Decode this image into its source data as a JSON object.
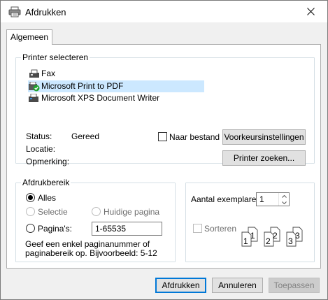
{
  "window": {
    "title": "Afdrukken"
  },
  "tabs": [
    {
      "label": "Algemeen"
    }
  ],
  "printer_group": {
    "title": "Printer selecteren",
    "printers": [
      {
        "name": "Fax",
        "selected": false
      },
      {
        "name": "Microsoft Print to PDF",
        "selected": true
      },
      {
        "name": "Microsoft XPS Document Writer",
        "selected": false
      }
    ],
    "status_label": "Status:",
    "status_value": "Gereed",
    "location_label": "Locatie:",
    "comment_label": "Opmerking:",
    "print_to_file_label": "Naar bestand",
    "print_to_file_checked": false,
    "preferences_button": "Voorkeursinstellingen",
    "find_printer_button": "Printer zoeken..."
  },
  "range_group": {
    "title": "Afdrukbereik",
    "all_label": "Alles",
    "selection_label": "Selectie",
    "current_page_label": "Huidige pagina",
    "pages_label": "Pagina's:",
    "pages_value": "1-65535",
    "selected_option": "all",
    "help_line1": "Geef een enkel paginanummer of",
    "help_line2": "paginabereik op. Bijvoorbeeld: 5-12"
  },
  "copies_group": {
    "copies_label": "Aantal exemplaren:",
    "copies_value": "1",
    "collate_label": "Sorteren",
    "collate_checked": false,
    "collate_pages": [
      "1",
      "1",
      "2",
      "2",
      "3",
      "3"
    ]
  },
  "buttons": {
    "print": "Afdrukken",
    "cancel": "Annuleren",
    "apply": "Toepassen"
  },
  "colors": {
    "selected_row": "#cce8ff",
    "default_button_border": "#0078d7",
    "pdf_badge": "#1fa22e"
  }
}
